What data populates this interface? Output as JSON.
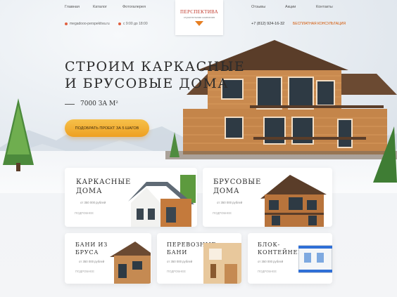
{
  "nav": {
    "left": [
      "Главная",
      "Каталог",
      "Фотогалерея"
    ],
    "right": [
      "Отзывы",
      "Акции",
      "Контакты"
    ]
  },
  "contacts": {
    "email": "megadooo-perspektiva.ru",
    "hours": "с 9:00 до 18:00"
  },
  "logo": {
    "name": "ПЕРСПЕКТИВА",
    "subtitle": "строительная компания"
  },
  "phone": "+7 (812) 924-16-32",
  "consult": "БЕСПЛАТНАЯ КОНСУЛЬТАЦИЯ",
  "hero": {
    "title_line1": "СТРОИМ КАРКАСНЫЕ",
    "title_line2": "И БРУСОВЫЕ ДОМА",
    "price": "7000 ЗА М²",
    "cta": "ПОДОБРАТЬ ПРОЕКТ ЗА 5 ШАГОВ"
  },
  "cards": [
    {
      "title1": "КАРКАСНЫЕ",
      "title2": "ДОМА",
      "from": "от 350 000 рублей",
      "more": "ПОДРОБНЕЕ"
    },
    {
      "title1": "БРУСОВЫЕ",
      "title2": "ДОМА",
      "from": "от 350 000 рублей",
      "more": "ПОДРОБНЕЕ"
    },
    {
      "title1": "БАНИ ИЗ",
      "title2": "БРУСА",
      "from": "от 350 000 рублей",
      "more": "ПОДРОБНЕЕ"
    },
    {
      "title1": "ПЕРЕВОЗНЫЕ",
      "title2": "БАНИ",
      "from": "от 350 000 рублей",
      "more": "ПОДРОБНЕЕ"
    },
    {
      "title1": "БЛОК-",
      "title2": "КОНТЕЙНЕРЫ",
      "from": "от 350 000 рублей",
      "more": "ПОДРОБНЕЕ"
    }
  ]
}
